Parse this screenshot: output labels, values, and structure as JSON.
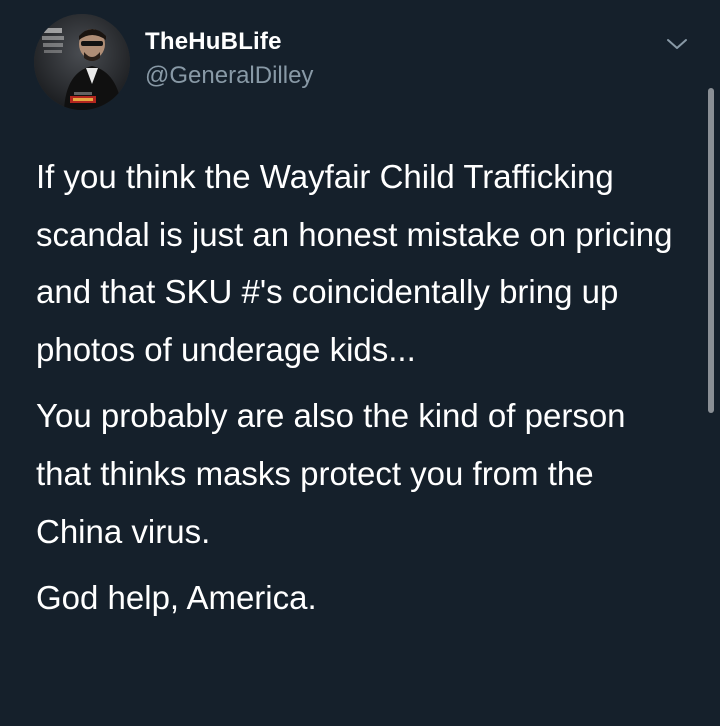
{
  "tweet": {
    "display_name": "TheHuBLife",
    "handle": "@GeneralDilley",
    "paragraphs": [
      "If you think the Wayfair Child Trafficking scandal is just an honest mistake on pricing and that SKU #'s coincidentally bring up photos of underage kids...",
      "You probably are also the kind of person that thinks masks protect you from the China virus.",
      "God help, America."
    ]
  },
  "icons": {
    "avatar": "profile-photo",
    "menu": "chevron-down-icon"
  },
  "colors": {
    "background": "#15202b",
    "text_primary": "#ffffff",
    "text_secondary": "#8899a6"
  }
}
